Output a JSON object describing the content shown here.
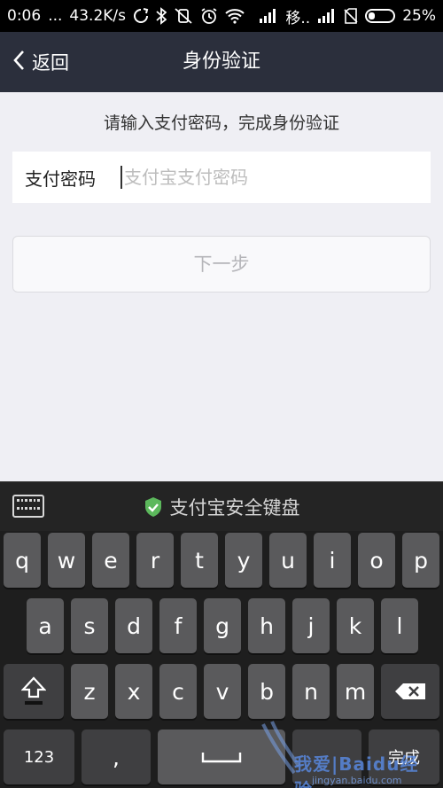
{
  "status_bar": {
    "time": "0:06",
    "dots": "...",
    "speed": "43.2K/s",
    "carrier": "移..",
    "battery": "25%"
  },
  "nav": {
    "back_label": "返回",
    "title": "身份验证"
  },
  "main": {
    "hint": "请输入支付密码，完成身份验证",
    "password_label": "支付密码",
    "password_placeholder": "支付宝支付密码",
    "next_button": "下一步"
  },
  "keyboard": {
    "title": "支付宝安全键盘",
    "row1": [
      "q",
      "w",
      "e",
      "r",
      "t",
      "y",
      "u",
      "i",
      "o",
      "p"
    ],
    "row2": [
      "a",
      "s",
      "d",
      "f",
      "g",
      "h",
      "j",
      "k",
      "l"
    ],
    "row3": [
      "z",
      "x",
      "c",
      "v",
      "b",
      "n",
      "m"
    ],
    "num_key": "123",
    "comma_key": ",",
    "done_key": "完成"
  },
  "watermark": {
    "text": "我爱|Baidu经验",
    "url": "jingyan.baidu.com"
  },
  "colors": {
    "nav_bg": "#2b2f3c",
    "page_bg": "#efeff4",
    "key_bg": "#5a5a5c",
    "shield_green": "#5cb85c"
  }
}
